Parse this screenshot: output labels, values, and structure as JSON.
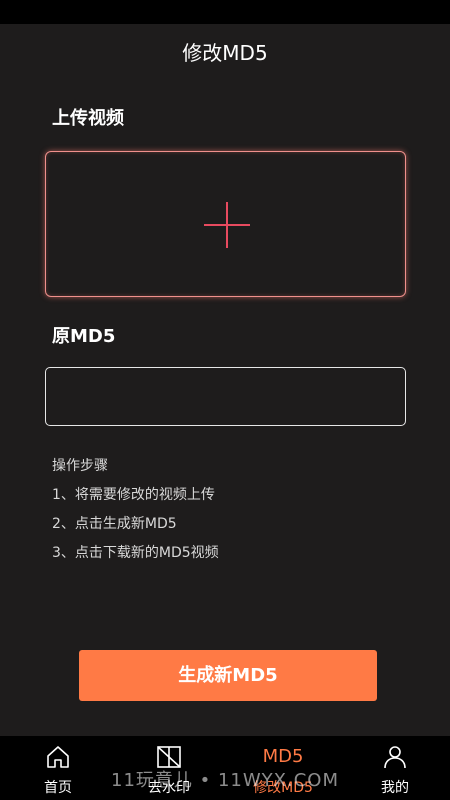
{
  "header": {
    "title": "修改MD5"
  },
  "upload": {
    "label": "上传视频"
  },
  "md5": {
    "label": "原MD5",
    "value": ""
  },
  "steps": {
    "title": "操作步骤",
    "items": [
      "1、将需要修改的视频上传",
      "2、点击生成新MD5",
      "3、点击下载新的MD5视频"
    ]
  },
  "generate_button": {
    "label": "生成新MD5"
  },
  "tabbar": {
    "tabs": [
      {
        "label": "首页",
        "icon": "home-icon"
      },
      {
        "label": "去水印",
        "icon": "watermark-remove-icon"
      },
      {
        "label": "修改MD5",
        "icon_text": "MD5",
        "active": true
      },
      {
        "label": "我的",
        "icon": "user-icon"
      }
    ]
  },
  "overlay": {
    "watermark_text": "11玩意儿 • 11WYX.COM"
  },
  "colors": {
    "accent": "#ff7a45",
    "plus": "#e84a5f",
    "background": "#1e1c1c"
  }
}
